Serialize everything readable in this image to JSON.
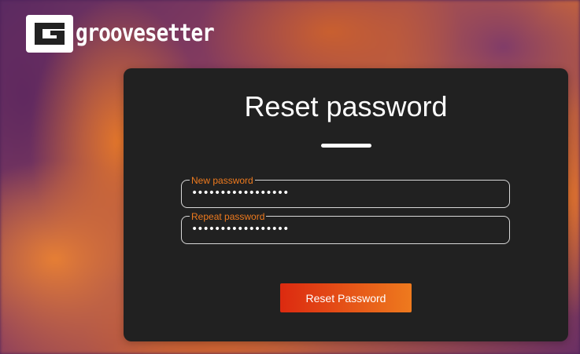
{
  "brand": {
    "mark_letter": "G",
    "name": "groovesetter"
  },
  "reset_form": {
    "title": "Reset password",
    "new_password": {
      "label": "New password",
      "value": "•••••••••••••••••"
    },
    "repeat_password": {
      "label": "Repeat password",
      "value": "•••••••••••••••••"
    },
    "submit_label": "Reset Password"
  },
  "colors": {
    "accent_orange": "#ee7a1e",
    "accent_red": "#dc2a10",
    "card_background": "#212121",
    "text_primary": "#ffffff"
  }
}
